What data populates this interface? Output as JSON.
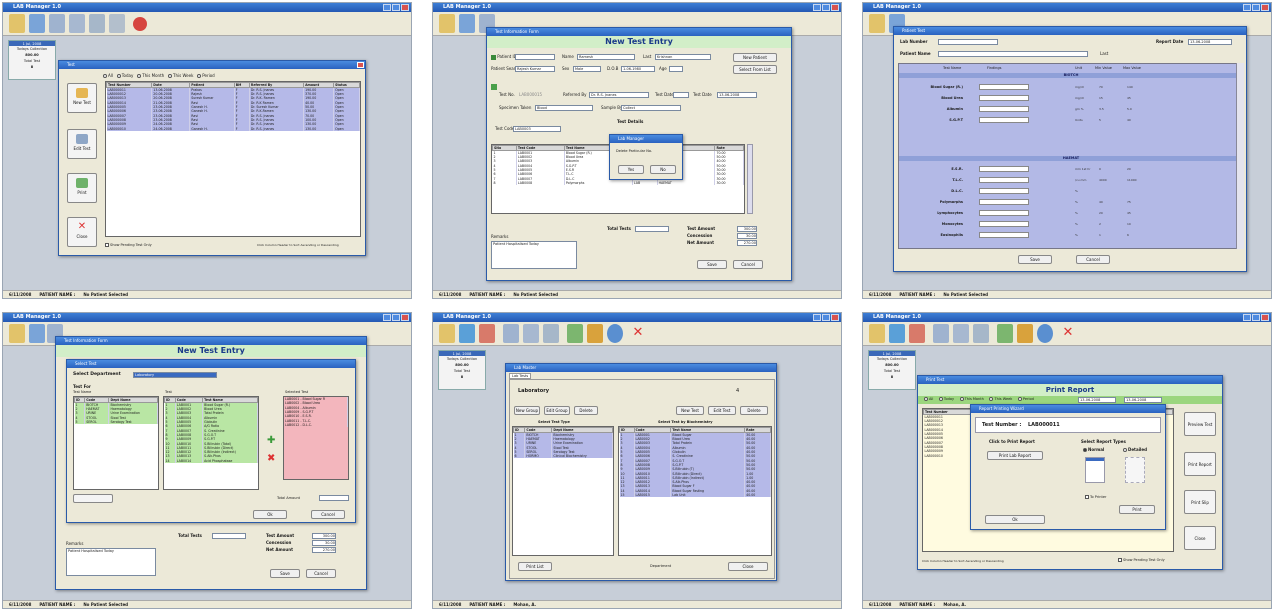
{
  "app": {
    "window_title": "LAB Manager 1.0"
  },
  "status": {
    "date": "6/11/2008",
    "patient_label": "PATIENT NAME :",
    "no_patient": "No Patient Selected",
    "patient_name": "Mohan, A.",
    "patient_name2": "Mohan, A."
  },
  "sidebox": {
    "title": "1 Jul, 2008",
    "today": "Todays Collection",
    "amount": "800.00",
    "total_test": "Total Test",
    "count": "8"
  },
  "p1": {
    "dialog_title": "Test",
    "filters": [
      "All",
      "Today",
      "This Month",
      "This Week",
      "Period"
    ],
    "buttons": {
      "new": "New Test",
      "edit": "Edit Test",
      "print": "Print",
      "close": "Close"
    },
    "columns": [
      "Test Number",
      "Date",
      "Patient",
      "BM",
      "Referred By",
      "Amount",
      "Status"
    ],
    "rows": [
      [
        "LAB000011",
        "13-06-2008",
        "Prakas",
        "F",
        "Dr. R.S. Jnanes",
        "190.00",
        "Open"
      ],
      [
        "LAB000012",
        "20-06-2008",
        "Rajesh",
        "F",
        "Dr. R.S. Jnanes",
        "370.00",
        "Open"
      ],
      [
        "LAB000013",
        "20-06-2008",
        "Suresh Kumar",
        "F",
        "Dr. R.K. Ramen",
        "190.00",
        "Open"
      ],
      [
        "LAB000014",
        "21-06-2008",
        "Ravi",
        "F",
        "Dr. R.K Ramen",
        "40.00",
        "Open"
      ],
      [
        "LAB000005",
        "23-06-2008",
        "Ganesh H.",
        "F",
        "Dr. Suresh Kumar",
        "50.00",
        "Open"
      ],
      [
        "LAB000006",
        "23-06-2008",
        "Ganesh H.",
        "F",
        "Dr. R.K.Ramen",
        "130.00",
        "Open"
      ],
      [
        "LAB000007",
        "23-06-2008",
        "Ravi",
        "F",
        "Dr. R.S. Jnanes",
        "70.00",
        "Open"
      ],
      [
        "LAB000008",
        "23-06-2008",
        "Ravi",
        "F",
        "Dr. R.S. Jnanes",
        "100.00",
        "Open"
      ],
      [
        "LAB000009",
        "24-06-2008",
        "Ravi",
        "F",
        "Dr. R.S. Jnanes",
        "130.00",
        "Open"
      ],
      [
        "LAB000010",
        "24-06-2008",
        "Ganesh H.",
        "F",
        "Dr. R.S. Jnanes",
        "130.00",
        "Open"
      ]
    ],
    "show_pending": "Show Pending Test Only",
    "hint": "Click Column Header to Sort Ascending or Descending"
  },
  "p2": {
    "dialog_title": "Test Information Form",
    "heading": "New Test Entry",
    "patient_id_label": "Patient ID",
    "patient_id": "",
    "name_label": "Name",
    "name_value": "Ramesh",
    "last_label": "Last",
    "last_value": "Krishnan",
    "new_patient": "New Patient",
    "patient_search_label": "Patient Search",
    "patient_search": "Rajesh Kumar",
    "sex_label": "Sex",
    "sex_value": "Male",
    "dob_label": "D.O.B",
    "dob_value": "1-06-1980",
    "age_label": "Age",
    "select_from_list": "Select From List",
    "test_no_label": "Test No.",
    "test_no": "LAB000015",
    "ref_by_label": "Referred By",
    "ref_by": "Dr. R.S. Jnanes",
    "test_date_label": "Test Date",
    "report_date_label": "Test Date",
    "report_date": "13-06-2008",
    "specimen_label": "Specimen Taken",
    "specimen": "Blood",
    "sample_by_label": "Sample By",
    "sample_by": "Collect",
    "test_details": "Test Details",
    "test_code_label": "Test Code",
    "test_code": "LAB0003",
    "columns": [
      "SNo",
      "Test Code",
      "Test Name",
      "Unit",
      "Department",
      "Rate"
    ],
    "rows": [
      [
        "1",
        "LAB0001",
        "Blood Sugar (R.)",
        "LAB",
        "BIOTCH",
        "70.00"
      ],
      [
        "2",
        "LAB0002",
        "Blood Urea",
        "LAB",
        "BIOTCH",
        "50.00"
      ],
      [
        "3",
        "LAB0003",
        "Albumin",
        "LAB",
        "BIOTCH",
        "40.00"
      ],
      [
        "4",
        "LAB0004",
        "S.G.P.T",
        "LAB",
        "BIOTCH",
        "50.00"
      ],
      [
        "5",
        "LAB0005",
        "E.S.R",
        "LAB",
        "HAEMAT",
        "30.00"
      ],
      [
        "6",
        "LAB0006",
        "T.L.C",
        "LAB",
        "HAEMAT",
        "30.00"
      ],
      [
        "7",
        "LAB0007",
        "D.L.C",
        "LAB",
        "HAEMAT",
        "30.00"
      ],
      [
        "8",
        "LAB0008",
        "Polymorphs",
        "LAB",
        "HAEMAT",
        "30.00"
      ]
    ],
    "msg_title": "Lab Manager",
    "msg_text": "Delete Particular No.",
    "msg_yes": "Yes",
    "msg_no": "No",
    "remarks_label": "Remarks",
    "remarks": "Patient Hospitalised Today",
    "total_tests_label": "Total Tests",
    "test_amount_label": "Test Amount",
    "test_amount": "300.00",
    "concession_label": "Concession",
    "concession": "30.00",
    "net_amount_label": "Net Amount",
    "net_amount": "270.00",
    "save": "Save",
    "cancel": "Cancel"
  },
  "p3": {
    "dialog_title": "Patient Test",
    "lab_number_label": "Lab Number",
    "report_date_label": "Report Date",
    "report_date": "13-06-2008",
    "patient_name_label": "Patient Name",
    "last_label": "Last",
    "columns": [
      "Test Name",
      "Findings",
      "Unit",
      "Min Value",
      "Max Value"
    ],
    "section1": "BIOTCH",
    "section2": "HAEMAT",
    "rows1": [
      [
        "Blood Sugar (R.)",
        "mg/dl",
        "70",
        "140"
      ],
      [
        "Blood Urea",
        "mg/dl",
        "15",
        "45"
      ],
      [
        "Albumin",
        "gm %",
        "3.5",
        "5.0"
      ],
      [
        "S.G.P.T",
        "Units",
        "5",
        "40"
      ]
    ],
    "rows2": [
      [
        "E.S.R.",
        "mm 1st hr",
        "0",
        "20"
      ],
      [
        "T.L.C.",
        "/cu mm",
        "4000",
        "11000"
      ],
      [
        "D.L.C.",
        "%",
        "",
        ""
      ],
      [
        "Polymorphs",
        "%",
        "40",
        "75"
      ],
      [
        "Lymphocytes",
        "%",
        "20",
        "45"
      ],
      [
        "Monocytes",
        "%",
        "2",
        "10"
      ],
      [
        "Eosinophils",
        "%",
        "1",
        "6"
      ]
    ],
    "save": "Save",
    "cancel": "Cancel"
  },
  "p4": {
    "dialog_title": "Test Information Form",
    "heading": "New Test Entry",
    "select_title": "Select Test",
    "select_dept_label": "Select Department",
    "select_dept": "Laboratory",
    "test_for": "Test For",
    "test_name_label": "Test Name",
    "test_label": "Test",
    "dept_columns": [
      "ID",
      "Code",
      "Dept Name"
    ],
    "dept_rows": [
      [
        "1",
        "BIOTCH",
        "Biochemistry"
      ],
      [
        "2",
        "HAEMAT",
        "Haematology"
      ],
      [
        "3",
        "URINE",
        "Urine Examination"
      ],
      [
        "4",
        "STOOL",
        "Stool Test"
      ],
      [
        "5",
        "SEROL",
        "Serology Test"
      ]
    ],
    "test_columns": [
      "ID",
      "Code",
      "Test Name"
    ],
    "test_rows": [
      [
        "1",
        "LAB0001",
        "Blood Sugar (R.)"
      ],
      [
        "2",
        "LAB0002",
        "Blood Urea"
      ],
      [
        "3",
        "LAB0003",
        "Total Protein"
      ],
      [
        "4",
        "LAB0004",
        "Albumin"
      ],
      [
        "5",
        "LAB0005",
        "Globulin"
      ],
      [
        "6",
        "LAB0006",
        "A/G Ratio"
      ],
      [
        "7",
        "LAB0007",
        "S. Creatinine"
      ],
      [
        "8",
        "LAB0008",
        "S.G.O.T"
      ],
      [
        "9",
        "LAB0009",
        "S.G.P.T"
      ],
      [
        "10",
        "LAB0010",
        "S.Bilirubin (Total)"
      ],
      [
        "11",
        "LAB0011",
        "S.Bilirubin (Direct)"
      ],
      [
        "12",
        "LAB0012",
        "S.Bilirubin (Indirect)"
      ],
      [
        "13",
        "LAB0013",
        "S.Alk.Phos"
      ],
      [
        "14",
        "LAB0014",
        "Acid Phosphatase"
      ]
    ],
    "selected_label": "Selected Test",
    "selected": [
      "LAB0001 - Blood Sugar R",
      "LAB0002 - Blood Urea",
      "LAB0004 - Albumin",
      "LAB0009 - S.G.P.T",
      "LAB0010 - E.S.R.",
      "LAB0011 - T.L.C.",
      "LAB0012 - D.L.C."
    ],
    "total_amount_label": "Total Amount",
    "ok": "Ok",
    "cancel": "Cancel",
    "remarks_label": "Remarks",
    "remarks": "Patient Hospitalised Today",
    "total_tests_label": "Total Tests",
    "test_amount_label": "Test Amount",
    "test_amount": "300.00",
    "concession_label": "Concession",
    "concession": "30.00",
    "net_amount_label": "Net Amount",
    "net_amount": "270.00",
    "save": "Save"
  },
  "p5": {
    "dialog_title": "Lab Master",
    "tab": "Lab Tests",
    "heading": "Laboratory",
    "new_group": "New Group",
    "edit_group": "Edit Group",
    "delete": "Delete",
    "new_test": "New Test",
    "edit_test": "Edit Test",
    "delete2": "Delete",
    "select_type_label": "Select Test Type",
    "select_test_label": "Select Test by Biochemistry",
    "type_columns": [
      "ID",
      "Code",
      "Dept Name"
    ],
    "type_rows": [
      [
        "1",
        "BIOTCH",
        "Biochemistry"
      ],
      [
        "2",
        "HAEMAT",
        "Haematology"
      ],
      [
        "3",
        "URINE",
        "Urine Examination"
      ],
      [
        "4",
        "STOOL",
        "Stool Test"
      ],
      [
        "5",
        "SEROL",
        "Serology Test"
      ],
      [
        "6",
        "HORMO",
        "Clinical Biochemistry"
      ]
    ],
    "test_columns": [
      "ID",
      "Code",
      "Test Name",
      "Rate"
    ],
    "test_rows": [
      [
        "1",
        "LAB0001",
        "Blood Sugar",
        "30.00"
      ],
      [
        "2",
        "LAB0002",
        "Blood Urea",
        "40.00"
      ],
      [
        "3",
        "LAB0003",
        "Total Protein",
        "50.00"
      ],
      [
        "4",
        "LAB0004",
        "Albumin",
        "40.00"
      ],
      [
        "5",
        "LAB0005",
        "Globulin",
        "40.00"
      ],
      [
        "6",
        "LAB0006",
        "S. Creatinine",
        "50.00"
      ],
      [
        "7",
        "LAB0007",
        "S.G.O.T",
        "50.00"
      ],
      [
        "8",
        "LAB0008",
        "S.G.P.T",
        "50.00"
      ],
      [
        "9",
        "LAB0009",
        "S.Bilirubin (T)",
        "50.00"
      ],
      [
        "10",
        "LAB0010",
        "S.Bilirubin (Direct)",
        "1.00"
      ],
      [
        "11",
        "LAB0011",
        "S.Bilirubin (Indirect)",
        "1.00"
      ],
      [
        "12",
        "LAB0012",
        "S.Alk.Phos",
        "40.00"
      ],
      [
        "13",
        "LAB0013",
        "Blood Sugar F",
        "40.00"
      ],
      [
        "14",
        "LAB0014",
        "Blood Sugar Fasting",
        "40.00"
      ],
      [
        "15",
        "LAB0015",
        "Lab Unit",
        "40.00"
      ]
    ],
    "print_list": "Print List",
    "department": "Department",
    "close": "Close"
  },
  "p6": {
    "dialog_title": "Print Test",
    "heading": "Print Report",
    "filters": [
      "All",
      "Today",
      "This Month",
      "This Week",
      "Period"
    ],
    "date_from": "13-06-2008",
    "date_to": "13-06-2008",
    "columns": [
      "Test Number",
      "Date"
    ],
    "rows": [
      "LAB000011",
      "LAB000012",
      "LAB000013",
      "LAB000014",
      "LAB000005",
      "LAB000006",
      "LAB000007",
      "LAB000008",
      "LAB000009",
      "LAB000010"
    ],
    "wizard_title": "Report Printing Wizard",
    "test_number_label": "Test Number :",
    "test_number": "LAB000011",
    "click_print": "Click to Print Report",
    "print_lab_report": "Print Lab Report",
    "select_type": "Select Report Types",
    "normal": "Normal",
    "detailed": "Detailed",
    "to_printer": "To Printer",
    "print": "Print",
    "ok": "Ok",
    "side_buttons": [
      "Preview Test",
      "Print Report",
      "Print Slip",
      "Close"
    ],
    "show_pending": "Show Pending Test Only",
    "hint": "Click Column Header to Sort Ascending or Descending"
  }
}
